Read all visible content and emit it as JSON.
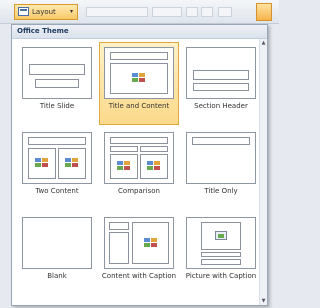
{
  "toolbar": {
    "layout_label": "Layout",
    "layout_arrow": "▾"
  },
  "panel": {
    "header": "Office Theme",
    "scroll_up": "▲",
    "scroll_down": "▼"
  },
  "layouts": [
    {
      "label": "Title Slide",
      "selected": false
    },
    {
      "label": "Title and Content",
      "selected": true
    },
    {
      "label": "Section Header",
      "selected": false
    },
    {
      "label": "Two Content",
      "selected": false
    },
    {
      "label": "Comparison",
      "selected": false
    },
    {
      "label": "Title Only",
      "selected": false
    },
    {
      "label": "Blank",
      "selected": false
    },
    {
      "label": "Content with Caption",
      "selected": false
    },
    {
      "label": "Picture with Caption",
      "selected": false
    }
  ]
}
